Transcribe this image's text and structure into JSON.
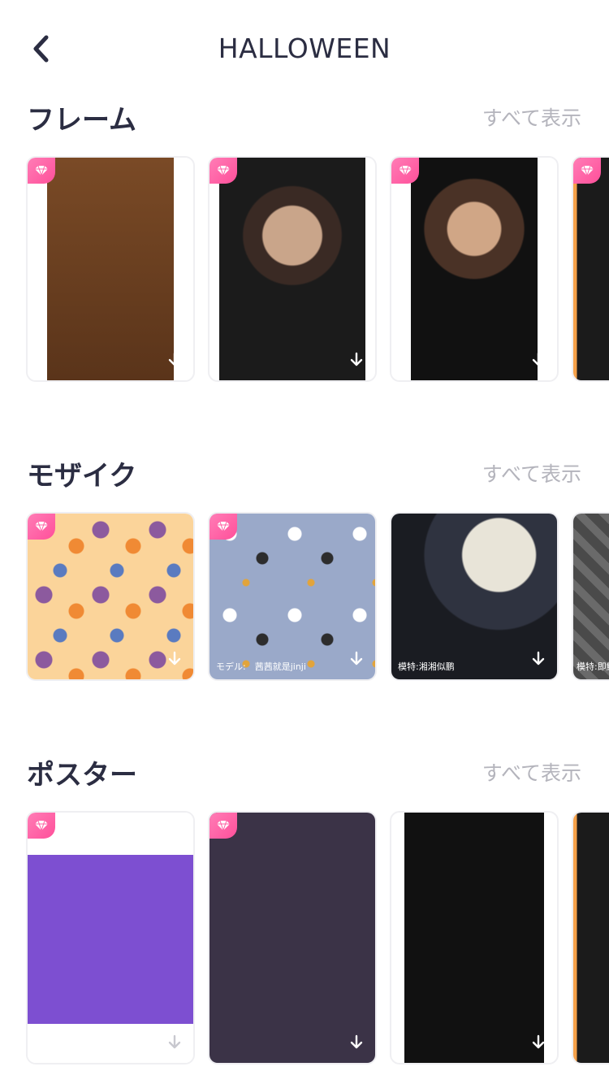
{
  "header": {
    "title": "HALLOWEEN",
    "back_icon": "chevron-left-icon"
  },
  "sections": [
    {
      "title": "フレーム",
      "see_all": "すべて表示",
      "cards": [
        {
          "name": "frame-wanted",
          "premium": true,
          "caption": "",
          "art": "wanted"
        },
        {
          "name": "frame-bunny",
          "premium": true,
          "caption": "",
          "art": "dark"
        },
        {
          "name": "frame-cracked",
          "premium": true,
          "caption": "",
          "art": "cracked"
        },
        {
          "name": "frame-partial",
          "premium": true,
          "caption": "",
          "art": "orange"
        }
      ]
    },
    {
      "title": "モザイク",
      "see_all": "すべて表示",
      "cards": [
        {
          "name": "mosaic-cupcakes",
          "premium": true,
          "caption": "",
          "art": "cupcakes"
        },
        {
          "name": "mosaic-spooky",
          "premium": true,
          "caption": "モデル:　茜茜就是jinji",
          "art": "spooky"
        },
        {
          "name": "mosaic-moon",
          "premium": false,
          "caption": "模特:湘湘似鹏",
          "art": "moon"
        },
        {
          "name": "mosaic-bats",
          "premium": false,
          "caption": "模特:即鮮力",
          "art": "bats"
        }
      ]
    },
    {
      "title": "ポスター",
      "see_all": "すべて表示",
      "cards": [
        {
          "name": "poster-halloween",
          "premium": true,
          "caption": "",
          "art": "collage"
        },
        {
          "name": "poster-happy-halloween",
          "premium": true,
          "caption": "",
          "art": "purple"
        },
        {
          "name": "poster-trick-or-treat",
          "premium": false,
          "caption": "",
          "art": "darkcollage"
        },
        {
          "name": "poster-partial",
          "premium": false,
          "caption": "",
          "art": "orange"
        }
      ]
    }
  ],
  "colors": {
    "premium_badge": "#ff5fa4",
    "title": "#2b2d42",
    "see_all": "#b4b4bc"
  }
}
